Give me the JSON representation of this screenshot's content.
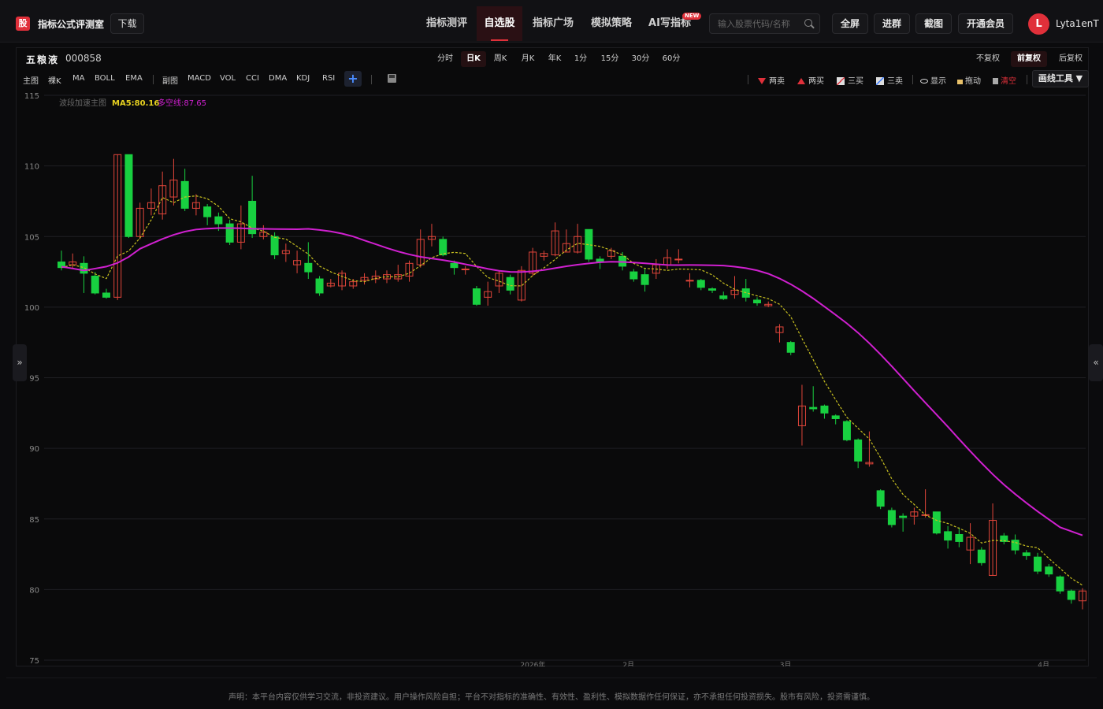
{
  "header": {
    "logo_char": "股",
    "brand": "指标公式评测室",
    "download": "下载",
    "nav": [
      "指标测评",
      "自选股",
      "指标广场",
      "模拟策略",
      "AI写指标"
    ],
    "new_badge": "NEW",
    "search_placeholder": "输入股票代码/名称",
    "buttons": [
      "全屏",
      "进群",
      "截图",
      "开通会员"
    ],
    "avatar_letter": "L",
    "username": "Lyta1enT"
  },
  "toolbar": {
    "stock_name": "五粮液",
    "stock_code": "000858",
    "periods": [
      "分时",
      "日K",
      "周K",
      "月K",
      "年K",
      "1分",
      "15分",
      "30分",
      "60分"
    ],
    "active_period": "日K",
    "fq": [
      "不复权",
      "前复权",
      "后复权"
    ],
    "active_fq": "前复权",
    "main_indicators": [
      "主图",
      "裸K",
      "MA",
      "BOLL",
      "EMA"
    ],
    "sub_indicators": [
      "副图",
      "MACD",
      "VOL",
      "CCI",
      "DMA",
      "KDJ",
      "RSI"
    ],
    "tools": {
      "two_sell": "两卖",
      "two_buy": "两买",
      "three_buy": "三买",
      "three_sell": "三卖",
      "show": "显示",
      "drag": "拖动",
      "clear": "清空",
      "draw_tools": "画线工具 ▼"
    }
  },
  "side": {
    "left": "»",
    "right": "«"
  },
  "chart_data": {
    "type": "candlestick",
    "legend": {
      "indicator": "波段加速主图",
      "ma5": "MA5:80.16",
      "bull_bear": "多空线:87.65",
      "ma5_color": "#e6d020",
      "bull_bear_color": "#d020d0"
    },
    "up_color": "#e0453a",
    "down_color": "#18d040",
    "ylim": [
      75,
      115
    ],
    "yticks": [
      75,
      80,
      85,
      90,
      95,
      100,
      105,
      110,
      115
    ],
    "xlabels": [
      "2026年",
      "2月",
      "3月",
      "4月"
    ],
    "candles": [
      [
        103.2,
        102.8,
        104.0,
        102.6
      ],
      [
        103.0,
        103.2,
        103.8,
        102.7
      ],
      [
        103.1,
        102.4,
        103.6,
        101.0
      ],
      [
        102.2,
        101.0,
        102.5,
        100.9
      ],
      [
        101.0,
        100.7,
        101.3,
        100.6
      ],
      [
        100.7,
        110.8,
        110.8,
        100.5
      ],
      [
        110.8,
        105.0,
        110.8,
        104.9
      ],
      [
        105.0,
        107.0,
        107.4,
        104.8
      ],
      [
        107.0,
        107.4,
        108.4,
        106.5
      ],
      [
        106.6,
        108.6,
        109.6,
        106.2
      ],
      [
        107.8,
        109.0,
        110.5,
        107.2
      ],
      [
        108.9,
        107.0,
        109.8,
        106.8
      ],
      [
        107.0,
        107.4,
        108.0,
        106.5
      ],
      [
        107.1,
        106.4,
        107.3,
        105.8
      ],
      [
        106.4,
        105.9,
        106.7,
        105.4
      ],
      [
        105.9,
        104.6,
        106.2,
        104.4
      ],
      [
        104.6,
        105.9,
        107.2,
        104.1
      ],
      [
        107.5,
        105.2,
        109.3,
        104.9
      ],
      [
        105.0,
        105.3,
        105.8,
        104.8
      ],
      [
        105.0,
        103.7,
        105.3,
        103.4
      ],
      [
        103.8,
        104.0,
        104.5,
        103.2
      ],
      [
        103.0,
        103.3,
        104.0,
        102.4
      ],
      [
        103.1,
        102.5,
        104.6,
        102.0
      ],
      [
        102.0,
        101.0,
        102.2,
        100.8
      ],
      [
        101.5,
        101.7,
        102.0,
        101.4
      ],
      [
        101.5,
        102.4,
        102.6,
        101.2
      ],
      [
        101.5,
        101.8,
        102.0,
        101.3
      ],
      [
        101.9,
        102.1,
        102.4,
        101.6
      ],
      [
        102.0,
        102.2,
        102.6,
        101.7
      ],
      [
        102.0,
        102.3,
        102.6,
        101.7
      ],
      [
        102.0,
        102.3,
        103.0,
        101.8
      ],
      [
        102.2,
        103.1,
        103.3,
        101.8
      ],
      [
        103.0,
        104.8,
        105.5,
        102.8
      ],
      [
        104.8,
        105.0,
        105.9,
        104.3
      ],
      [
        104.8,
        103.7,
        105.0,
        103.6
      ],
      [
        103.1,
        102.8,
        103.3,
        102.3
      ],
      [
        102.7,
        102.7,
        102.9,
        102.3
      ],
      [
        101.3,
        100.2,
        101.5,
        100.1
      ],
      [
        100.7,
        101.1,
        101.8,
        100.1
      ],
      [
        101.5,
        102.4,
        102.6,
        101.0
      ],
      [
        102.1,
        101.2,
        102.3,
        100.9
      ],
      [
        100.5,
        102.6,
        102.9,
        100.4
      ],
      [
        102.4,
        103.9,
        104.2,
        102.2
      ],
      [
        103.6,
        103.8,
        104.0,
        103.3
      ],
      [
        103.7,
        105.4,
        106.0,
        103.6
      ],
      [
        103.9,
        104.5,
        105.5,
        103.9
      ],
      [
        103.9,
        105.0,
        105.9,
        103.8
      ],
      [
        105.5,
        103.4,
        105.5,
        103.2
      ],
      [
        103.4,
        103.2,
        103.6,
        102.7
      ],
      [
        103.6,
        104.0,
        104.2,
        103.4
      ],
      [
        103.6,
        102.9,
        103.9,
        102.6
      ],
      [
        102.5,
        102.0,
        102.7,
        101.8
      ],
      [
        102.3,
        101.6,
        102.7,
        101.1
      ],
      [
        102.4,
        103.0,
        103.4,
        102.0
      ],
      [
        103.0,
        103.5,
        104.1,
        102.7
      ],
      [
        103.4,
        103.4,
        104.1,
        103.1
      ],
      [
        101.9,
        101.9,
        102.4,
        101.4
      ],
      [
        101.9,
        101.4,
        102.0,
        101.2
      ],
      [
        101.3,
        101.2,
        101.4,
        101.0
      ],
      [
        100.8,
        100.6,
        101.1,
        100.5
      ],
      [
        100.9,
        101.2,
        102.2,
        100.6
      ],
      [
        101.3,
        100.7,
        102.0,
        100.4
      ],
      [
        100.5,
        100.3,
        100.7,
        100.1
      ],
      [
        100.1,
        100.2,
        100.4,
        100.0
      ],
      [
        98.2,
        98.6,
        98.8,
        97.5
      ],
      [
        97.5,
        96.8,
        97.6,
        96.6
      ],
      [
        91.6,
        93.0,
        94.5,
        90.2
      ],
      [
        92.9,
        92.8,
        94.4,
        92.6
      ],
      [
        93.0,
        92.5,
        93.1,
        92.1
      ],
      [
        92.3,
        92.1,
        92.4,
        91.7
      ],
      [
        91.9,
        90.6,
        92.0,
        90.5
      ],
      [
        90.6,
        89.1,
        90.7,
        88.6
      ],
      [
        88.9,
        89.0,
        91.2,
        88.7
      ],
      [
        87.0,
        85.9,
        87.1,
        85.7
      ],
      [
        85.6,
        84.6,
        85.8,
        84.4
      ],
      [
        85.2,
        85.1,
        85.4,
        84.1
      ],
      [
        85.2,
        85.5,
        85.8,
        84.6
      ],
      [
        85.3,
        85.3,
        87.1,
        85.1
      ],
      [
        85.5,
        84.0,
        85.5,
        83.9
      ],
      [
        84.1,
        83.5,
        84.5,
        82.9
      ],
      [
        83.9,
        83.4,
        84.4,
        83.0
      ],
      [
        82.8,
        83.7,
        84.7,
        81.8
      ],
      [
        82.8,
        81.9,
        83.0,
        81.7
      ],
      [
        81.0,
        84.9,
        86.1,
        81.0
      ],
      [
        83.8,
        83.4,
        84.0,
        83.2
      ],
      [
        83.5,
        82.8,
        83.9,
        82.5
      ],
      [
        82.6,
        82.4,
        82.8,
        82.1
      ],
      [
        82.3,
        81.3,
        82.6,
        81.1
      ],
      [
        81.6,
        81.1,
        81.8,
        80.9
      ],
      [
        80.9,
        79.9,
        81.0,
        79.7
      ],
      [
        79.9,
        79.3,
        80.0,
        79.0
      ],
      [
        79.2,
        79.9,
        80.1,
        78.6
      ]
    ]
  }
}
